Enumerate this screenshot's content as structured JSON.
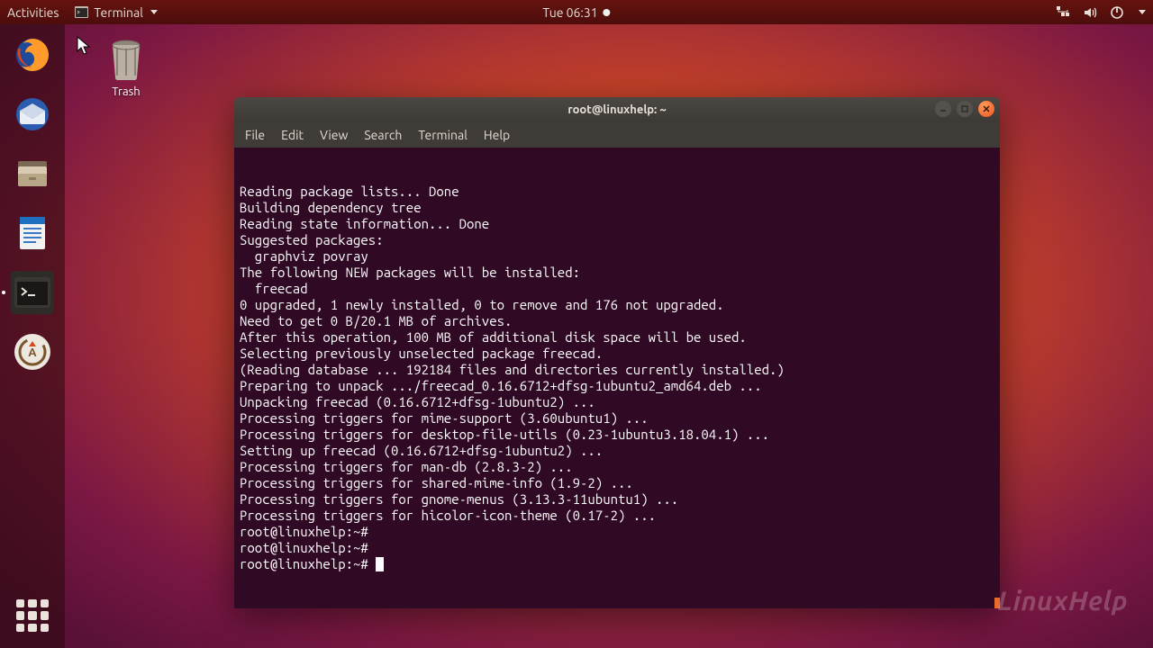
{
  "topbar": {
    "activities": "Activities",
    "app_name": "Terminal",
    "clock": "Tue 06:31"
  },
  "desktop": {
    "trash_label": "Trash"
  },
  "terminal": {
    "title": "root@linuxhelp: ~",
    "menu": {
      "file": "File",
      "edit": "Edit",
      "view": "View",
      "search": "Search",
      "terminal": "Terminal",
      "help": "Help"
    },
    "lines": [
      "Reading package lists... Done",
      "Building dependency tree",
      "Reading state information... Done",
      "Suggested packages:",
      "  graphviz povray",
      "The following NEW packages will be installed:",
      "  freecad",
      "0 upgraded, 1 newly installed, 0 to remove and 176 not upgraded.",
      "Need to get 0 B/20.1 MB of archives.",
      "After this operation, 100 MB of additional disk space will be used.",
      "Selecting previously unselected package freecad.",
      "(Reading database ... 192184 files and directories currently installed.)",
      "Preparing to unpack .../freecad_0.16.6712+dfsg-1ubuntu2_amd64.deb ...",
      "Unpacking freecad (0.16.6712+dfsg-1ubuntu2) ...",
      "Processing triggers for mime-support (3.60ubuntu1) ...",
      "Processing triggers for desktop-file-utils (0.23-1ubuntu3.18.04.1) ...",
      "Setting up freecad (0.16.6712+dfsg-1ubuntu2) ...",
      "Processing triggers for man-db (2.8.3-2) ...",
      "Processing triggers for shared-mime-info (1.9-2) ...",
      "Processing triggers for gnome-menus (3.13.3-11ubuntu1) ...",
      "Processing triggers for hicolor-icon-theme (0.17-2) ...",
      "root@linuxhelp:~#",
      "root@linuxhelp:~#"
    ],
    "prompt": "root@linuxhelp:~# "
  },
  "watermark": "LinuxHelp"
}
